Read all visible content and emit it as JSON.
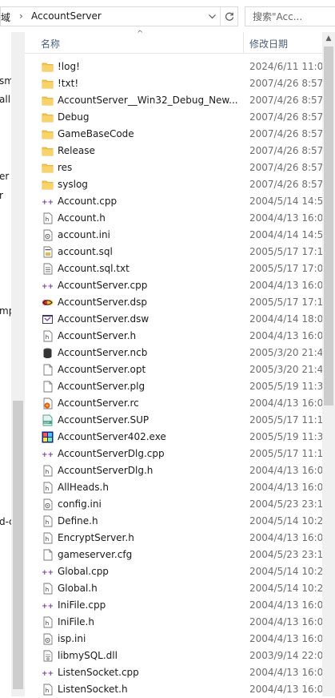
{
  "address": {
    "prefix": "域",
    "separator": "›",
    "path": "AccountServer",
    "dropdown_icon": "chevron-down",
    "refresh_icon": "refresh"
  },
  "search": {
    "placeholder": "搜索\"Acc..."
  },
  "nav_fragments": [
    "sm",
    "all",
    "er",
    "r",
    "mp",
    "d-c"
  ],
  "columns": {
    "name": "名称",
    "date": "修改日期",
    "sort_indicator": "^"
  },
  "files": [
    {
      "name": "!log!",
      "date": "2024/6/11 11:0",
      "icon": "folder"
    },
    {
      "name": "!txt!",
      "date": "2007/4/26 8:57",
      "icon": "folder"
    },
    {
      "name": "AccountServer__Win32_Debug_New...",
      "date": "2007/4/26 8:57",
      "icon": "folder"
    },
    {
      "name": "Debug",
      "date": "2007/4/26 8:57",
      "icon": "folder"
    },
    {
      "name": "GameBaseCode",
      "date": "2007/4/26 8:57",
      "icon": "folder"
    },
    {
      "name": "Release",
      "date": "2007/4/26 8:57",
      "icon": "folder"
    },
    {
      "name": "res",
      "date": "2007/4/26 8:57",
      "icon": "folder"
    },
    {
      "name": "syslog",
      "date": "2007/4/26 8:57",
      "icon": "folder"
    },
    {
      "name": "Account.cpp",
      "date": "2004/5/14 14:5",
      "icon": "cpp"
    },
    {
      "name": "Account.h",
      "date": "2004/4/13 16:0",
      "icon": "h"
    },
    {
      "name": "account.ini",
      "date": "2004/4/14 14:5",
      "icon": "ini"
    },
    {
      "name": "account.sql",
      "date": "2005/5/17 17:1",
      "icon": "sql"
    },
    {
      "name": "Account.sql.txt",
      "date": "2005/5/17 17:0",
      "icon": "txt"
    },
    {
      "name": "AccountServer.cpp",
      "date": "2004/4/13 16:0",
      "icon": "cpp"
    },
    {
      "name": "AccountServer.dsp",
      "date": "2005/5/17 17:1",
      "icon": "dsp"
    },
    {
      "name": "AccountServer.dsw",
      "date": "2004/4/14 18:0",
      "icon": "dsw"
    },
    {
      "name": "AccountServer.h",
      "date": "2004/4/13 16:0",
      "icon": "h"
    },
    {
      "name": "AccountServer.ncb",
      "date": "2005/3/20 21:4",
      "icon": "ncb"
    },
    {
      "name": "AccountServer.opt",
      "date": "2005/3/20 21:4",
      "icon": "blank"
    },
    {
      "name": "AccountServer.plg",
      "date": "2005/5/19 11:3",
      "icon": "blank"
    },
    {
      "name": "AccountServer.rc",
      "date": "2004/4/13 16:0",
      "icon": "rc"
    },
    {
      "name": "AccountServer.SUP",
      "date": "2005/5/17 11:1",
      "icon": "sup"
    },
    {
      "name": "AccountServer402.exe",
      "date": "2005/5/19 11:3",
      "icon": "exe"
    },
    {
      "name": "AccountServerDlg.cpp",
      "date": "2005/5/17 11:1",
      "icon": "cpp"
    },
    {
      "name": "AccountServerDlg.h",
      "date": "2004/4/13 16:0",
      "icon": "h"
    },
    {
      "name": "AllHeads.h",
      "date": "2004/4/13 16:0",
      "icon": "h"
    },
    {
      "name": "config.ini",
      "date": "2004/5/23 23:1",
      "icon": "ini"
    },
    {
      "name": "Define.h",
      "date": "2004/5/14 10:2",
      "icon": "h"
    },
    {
      "name": "EncryptServer.h",
      "date": "2004/4/13 16:0",
      "icon": "h"
    },
    {
      "name": "gameserver.cfg",
      "date": "2004/5/23 23:1",
      "icon": "blank"
    },
    {
      "name": "Global.cpp",
      "date": "2004/5/14 10:2",
      "icon": "cpp"
    },
    {
      "name": "Global.h",
      "date": "2004/5/14 10:2",
      "icon": "h"
    },
    {
      "name": "IniFile.cpp",
      "date": "2004/4/13 16:0",
      "icon": "cpp"
    },
    {
      "name": "IniFile.h",
      "date": "2004/4/13 16:0",
      "icon": "h"
    },
    {
      "name": "isp.ini",
      "date": "2004/4/13 16:0",
      "icon": "ini"
    },
    {
      "name": "libmySQL.dll",
      "date": "2003/9/14 22:0",
      "icon": "dll"
    },
    {
      "name": "ListenSocket.cpp",
      "date": "2004/4/13 16:0",
      "icon": "cpp"
    },
    {
      "name": "ListenSocket.h",
      "date": "2004/4/13 16:0",
      "icon": "h"
    }
  ],
  "colors": {
    "folder": "#f4c651",
    "folder_dark": "#e0a830",
    "cpp_accent": "#7a3e9e",
    "header_text": "#4c607a",
    "date_text": "#6d6d6d"
  }
}
